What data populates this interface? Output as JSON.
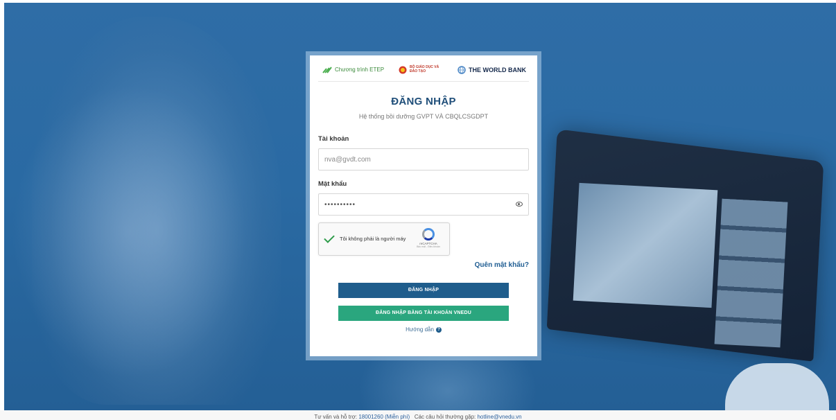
{
  "partners": {
    "etep": "Chương trình ETEP",
    "moet": "BỘ GIÁO DỤC VÀ ĐÀO TẠO",
    "worldbank": "THE WORLD BANK",
    "etep_icon": "etep-leaf-icon",
    "moet_icon": "national-emblem-icon",
    "worldbank_icon": "globe-icon"
  },
  "login": {
    "title": "ĐĂNG NHẬP",
    "subtitle": "Hệ thống bồi dưỡng GVPT VÀ CBQLCSGDPT",
    "account_label": "Tài khoản",
    "account_value": "nva@gvdt.com",
    "password_label": "Mật khẩu",
    "password_value": "••••••••••",
    "captcha_text": "Tôi không phải là người máy",
    "captcha_brand": "reCAPTCHA",
    "captcha_terms": "Bảo mật - Điều khoản",
    "forgot": "Quên mật khẩu?",
    "login_button": "ĐĂNG NHẬP",
    "vnedu_button": "ĐĂNG NHẬP BẰNG TÀI KHOẢN VNEDU",
    "guide": "Hướng dẫn",
    "guide_icon": "?"
  },
  "footer": {
    "support_prefix": "Tư vấn và hỗ trợ: ",
    "hotline": "18001260 (Miễn phí)",
    "faq_prefix": "Các câu hỏi thường gặp: ",
    "email": "hotline@vnedu.vn"
  },
  "colors": {
    "primary": "#1f5d8c",
    "accent_green": "#2aa67e",
    "title": "#1f4e79",
    "background": "#2a6aa3"
  }
}
